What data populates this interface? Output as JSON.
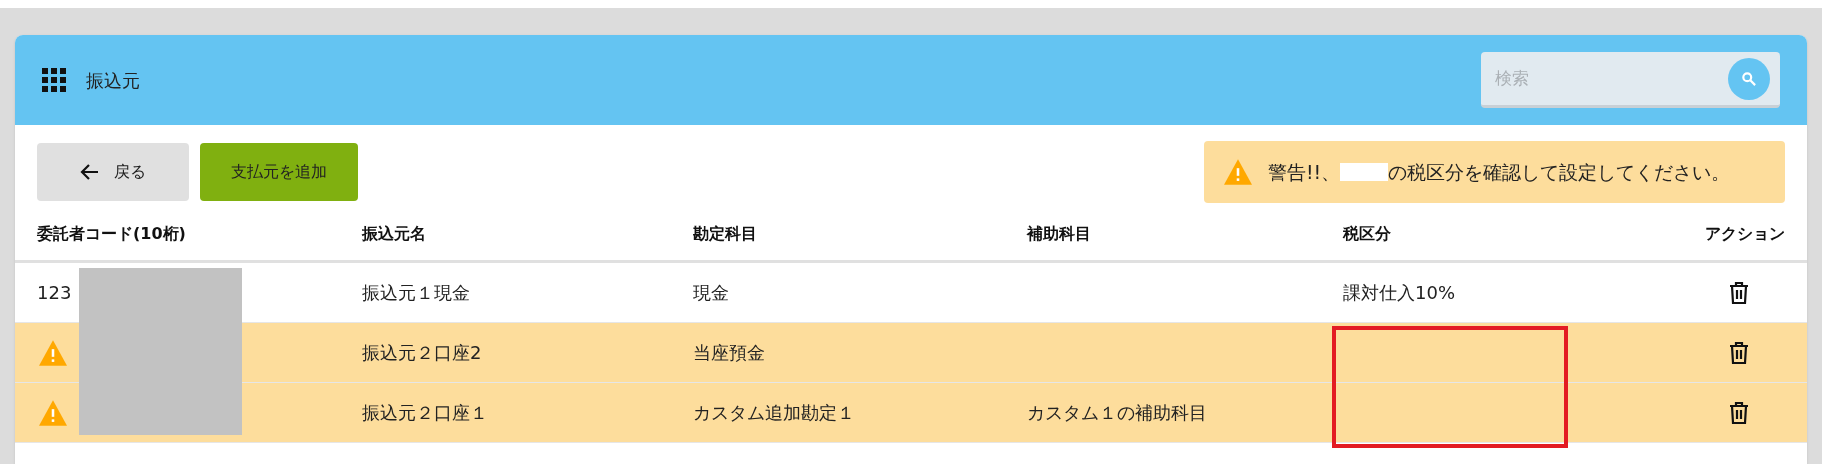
{
  "header": {
    "title": "振込元",
    "search": {
      "placeholder": "検索"
    }
  },
  "toolbar": {
    "back_button": "戻る",
    "add_button": "支払元を追加",
    "warning": {
      "before": "警告!!、",
      "after": "の税区分を確認して設定してください。"
    }
  },
  "table": {
    "columns": [
      "委託者コード(10桁)",
      "振込元名",
      "勘定科目",
      "補助科目",
      "税区分",
      "アクション"
    ],
    "rows": [
      {
        "warning": false,
        "code": "123",
        "name": "振込元１現金",
        "account": "現金",
        "sub_account": "",
        "tax": "課対仕入10%"
      },
      {
        "warning": true,
        "code": "",
        "name": "振込元２口座2",
        "account": "当座預金",
        "sub_account": "",
        "tax": ""
      },
      {
        "warning": true,
        "code": "",
        "name": "振込元２口座１",
        "account": "カスタム追加勘定１",
        "sub_account": "カスタム１の補助科目",
        "tax": ""
      }
    ]
  }
}
